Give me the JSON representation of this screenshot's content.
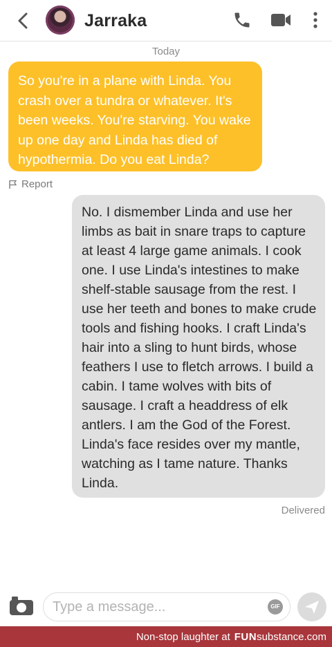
{
  "header": {
    "contact_name": "Jarraka"
  },
  "conversation": {
    "day_label": "Today",
    "incoming": {
      "text": "So you're in a plane with Linda. You crash over a tundra or whatever. It's been weeks. You're starving. You wake up one day and Linda has died of hypothermia. Do you eat Linda?",
      "report_label": "Report"
    },
    "outgoing": {
      "text": "No. I dismember Linda and use her limbs as bait in snare traps to capture at least 4 large game animals. I cook one. I use Linda's intestines to make shelf-stable sausage from the rest. I use her teeth and bones to make crude tools and fishing hooks. I craft Linda's hair into a sling to hunt birds, whose feathers I use to fletch arrows. I build a cabin. I tame wolves with bits of sausage. I craft a headdress of elk antlers. I am the God of the Forest. Linda's face resides over my mantle, watching as I tame nature. Thanks Linda.",
      "status": "Delivered"
    }
  },
  "composer": {
    "placeholder": "Type a message...",
    "gif_label": "GIF"
  },
  "watermark": {
    "text": "Non-stop laughter at",
    "brand_fun": "FUN",
    "brand_rest": "substance",
    "brand_tld": ".com"
  },
  "colors": {
    "incoming_bubble": "#fdc029",
    "outgoing_bubble": "#e0e0e0",
    "footer": "#a8363b"
  },
  "icons": [
    "back-chevron-icon",
    "phone-icon",
    "video-camera-icon",
    "more-vertical-icon",
    "flag-icon",
    "camera-icon",
    "gif-icon",
    "send-icon"
  ]
}
